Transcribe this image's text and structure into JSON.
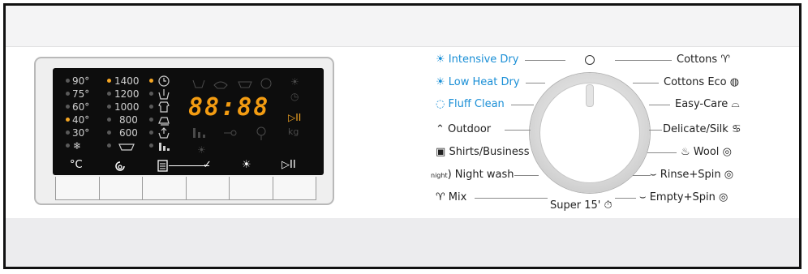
{
  "display": {
    "temps": [
      "90°",
      "75°",
      "60°",
      "40°",
      "30°"
    ],
    "cold_icon": "❄",
    "spins": [
      "1400",
      "1200",
      "1000",
      "800",
      "600"
    ],
    "segments": "88:88",
    "kg": "kg",
    "buttons": [
      "°C",
      "spin-icon",
      "options-icon",
      "✓",
      "intensive-dry-icon",
      "start-pause-icon"
    ]
  },
  "programmes_left": [
    {
      "label": "Intensive Dry",
      "color": "blue"
    },
    {
      "label": "Low Heat Dry",
      "color": "blue"
    },
    {
      "label": "Fluff Clean",
      "color": "blue"
    },
    {
      "label": "Outdoor",
      "color": "dark"
    },
    {
      "label": "Shirts/Business",
      "color": "dark"
    },
    {
      "label": "Night wash",
      "color": "dark"
    },
    {
      "label": "Mix",
      "color": "dark"
    }
  ],
  "programmes_right": [
    {
      "label": "Cottons"
    },
    {
      "label": "Cottons Eco"
    },
    {
      "label": "Easy-Care"
    },
    {
      "label": "Delicate/Silk"
    },
    {
      "label": "Wool"
    },
    {
      "label": "Rinse+Spin"
    },
    {
      "label": "Empty+Spin"
    }
  ],
  "bottom_programme": "Super 15'",
  "night_tag": "night",
  "colors": {
    "accent_blue": "#1a8fd6",
    "amber": "#f5a623",
    "display_bg": "#0d0d0d"
  }
}
